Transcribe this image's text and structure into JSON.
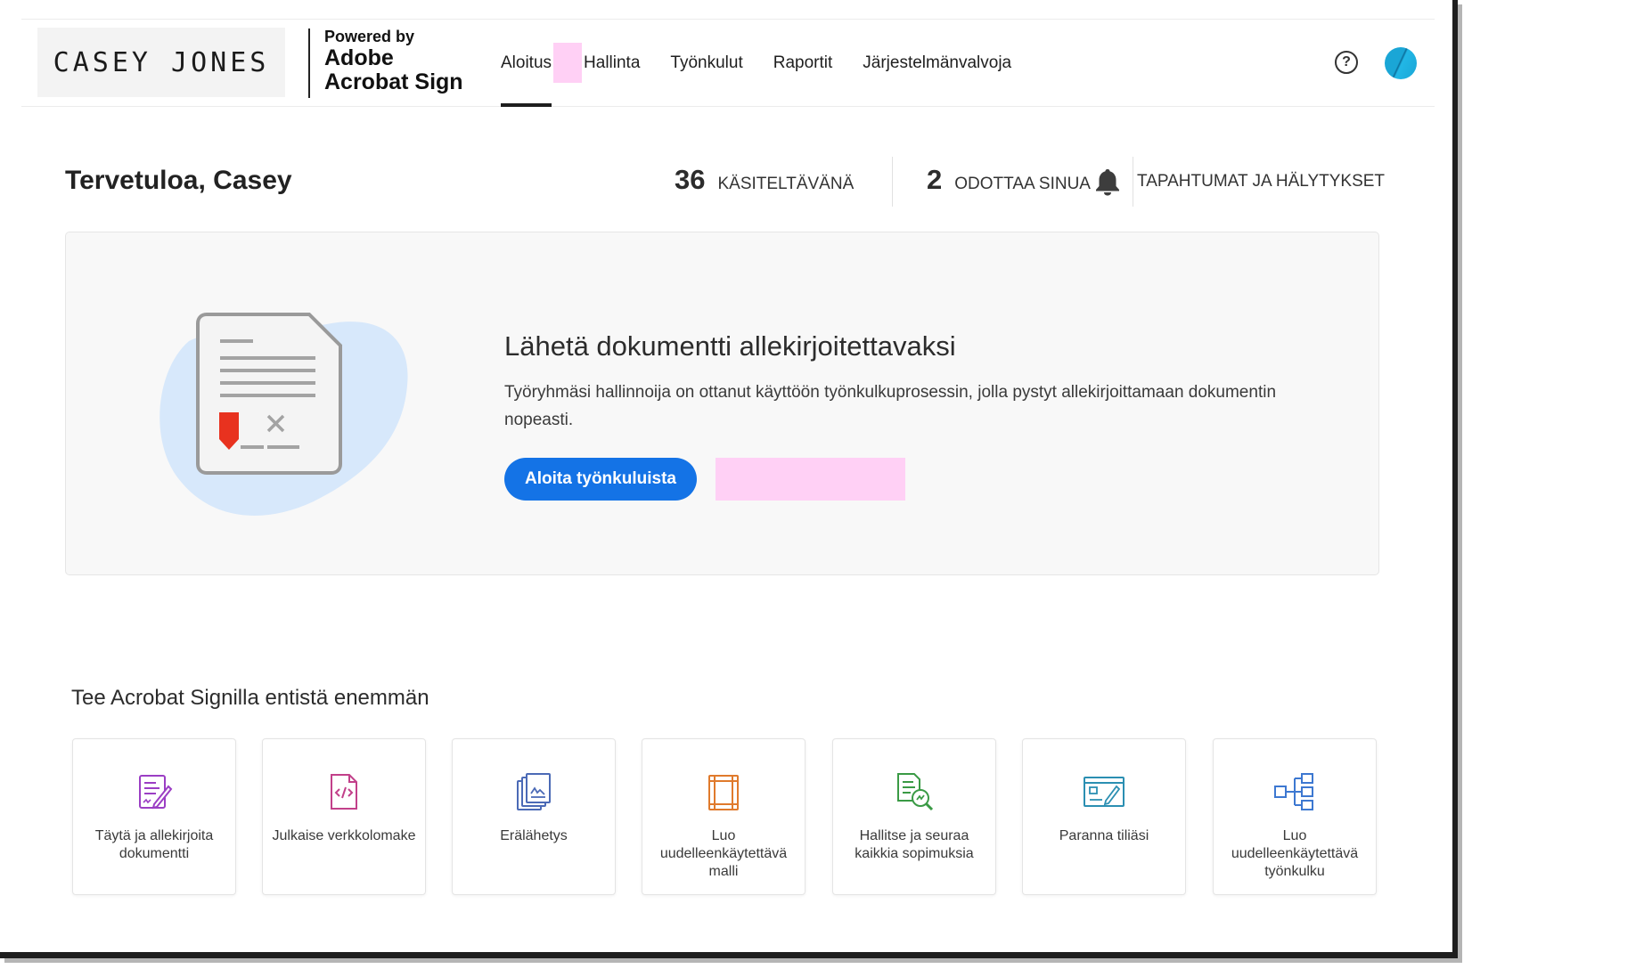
{
  "brand": {
    "logo_text": "CASEY JONES",
    "powered_by": "Powered by",
    "product_line1": "Adobe",
    "product_line2": "Acrobat Sign"
  },
  "nav": {
    "tabs": [
      {
        "label": "Aloitus",
        "active": true
      },
      {
        "label": "Hallinta",
        "active": false
      },
      {
        "label": "Työnkulut",
        "active": false
      },
      {
        "label": "Raportit",
        "active": false
      },
      {
        "label": "Järjestelmänvalvoja",
        "active": false
      }
    ],
    "help_icon": "?"
  },
  "welcome": {
    "title": "Tervetuloa, Casey",
    "stats": [
      {
        "count": "36",
        "label": "KÄSITELTÄVÄNÄ"
      },
      {
        "count": "2",
        "label": "ODOTTAA SINUA"
      }
    ],
    "events_label": "TAPAHTUMAT JA HÄLYTYKSET"
  },
  "hero": {
    "title": "Lähetä dokumentti allekirjoitettavaksi",
    "description": "Työryhmäsi hallinnoija on ottanut käyttöön työnkulkuprosessin, jolla pystyt allekirjoittamaan dokumentin nopeasti.",
    "button_label": "Aloita työnkuluista"
  },
  "more": {
    "title": "Tee Acrobat Signilla entistä enemmän",
    "tiles": [
      {
        "label": "Täytä ja allekirjoita dokumentti",
        "icon": "fill-sign-icon",
        "color": "#9b3ec4"
      },
      {
        "label": "Julkaise verkkolomake",
        "icon": "web-form-icon",
        "color": "#c2408a"
      },
      {
        "label": "Erälähetys",
        "icon": "bulk-send-icon",
        "color": "#4b6ab6"
      },
      {
        "label": "Luo uudelleenkäytettävä malli",
        "icon": "template-icon",
        "color": "#e07a2c"
      },
      {
        "label": "Hallitse ja seuraa kaikkia sopimuksia",
        "icon": "manage-agreements-icon",
        "color": "#3a9a45"
      },
      {
        "label": "Paranna tiliäsi",
        "icon": "upgrade-account-icon",
        "color": "#2b8fb2"
      },
      {
        "label": "Luo uudelleenkäytettävä työnkulku",
        "icon": "workflow-icon",
        "color": "#3d78d1"
      }
    ]
  },
  "colors": {
    "accent": "#1473e6",
    "highlight": "#ffd0f5",
    "signature_flag": "#e8321f"
  }
}
